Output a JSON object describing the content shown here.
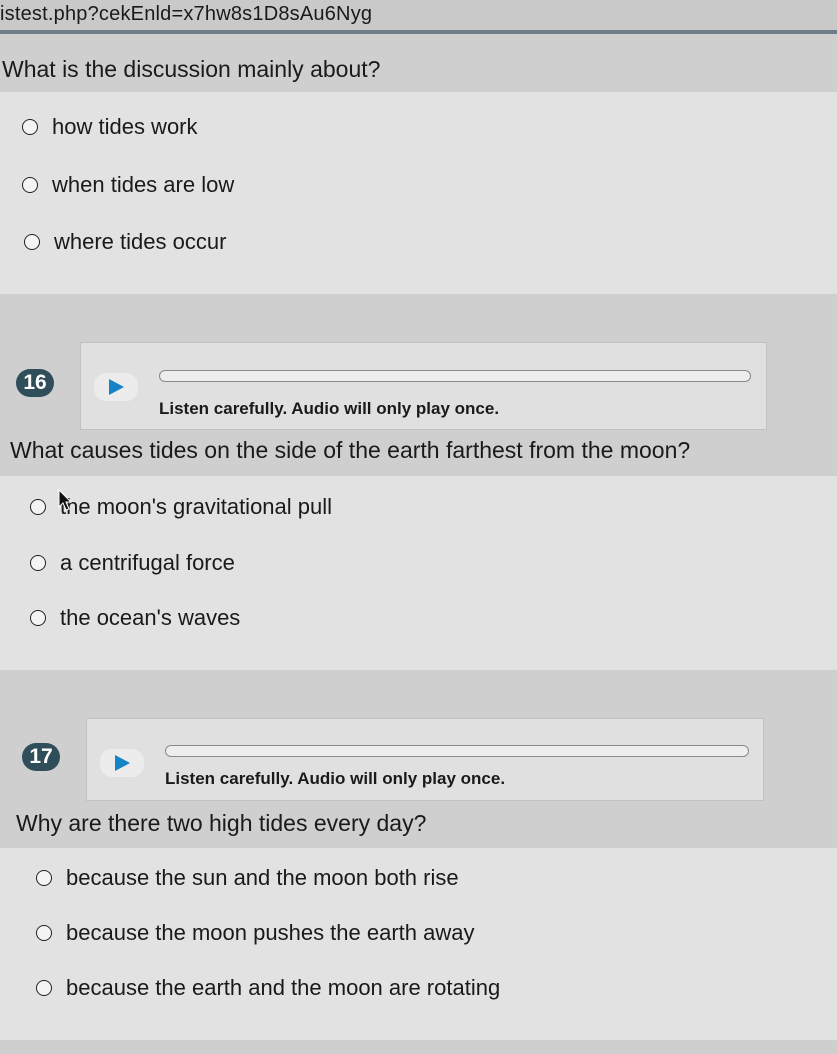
{
  "browser": {
    "url": "istest.php?cekEnld=x7hw8s1D8sAu6Nyg"
  },
  "q15": {
    "question": "What is the discussion mainly about?",
    "options": [
      "how tides work",
      "when tides are low",
      "where tides occur"
    ]
  },
  "q16": {
    "number": "16",
    "instruction": "Listen carefully. Audio will only play once.",
    "question": "What causes tides on the side of the earth farthest from the moon?",
    "options": [
      "the moon's gravitational pull",
      "a centrifugal force",
      "the ocean's waves"
    ]
  },
  "q17": {
    "number": "17",
    "instruction": "Listen carefully. Audio will only play once.",
    "question": "Why are there two high tides every day?",
    "options": [
      "because the sun and the moon both rise",
      "because the moon pushes the earth away",
      "because the earth and the moon are rotating"
    ]
  },
  "icons": {
    "play": "play-icon",
    "radio": "radio-circle-icon",
    "cursor": "mouse-pointer-icon"
  },
  "colors": {
    "badge": "#2f4e59",
    "play_triangle": "#1583c6"
  }
}
